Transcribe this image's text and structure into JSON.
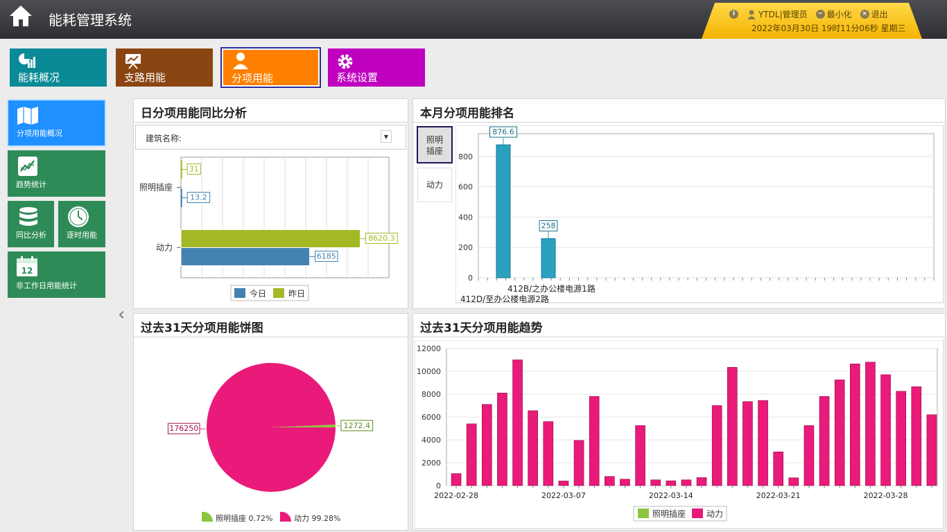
{
  "header": {
    "title": "能耗管理系统",
    "user": "YTDL|管理员",
    "minimize": "最小化",
    "logout": "退出",
    "datetime": "2022年03月30日 19时11分06秒 星期三"
  },
  "nav": {
    "items": [
      {
        "label": "能耗概况",
        "color": "#0a8a96"
      },
      {
        "label": "支路用能",
        "color": "#8b4513"
      },
      {
        "label": "分项用能",
        "color": "#ff8000"
      },
      {
        "label": "系统设置",
        "color": "#bf00bf"
      }
    ]
  },
  "sidebar": {
    "items": [
      {
        "label": "分项用能概况"
      },
      {
        "label": "趋势统计"
      },
      {
        "label": "同比分析"
      },
      {
        "label": "逐时用能"
      },
      {
        "label": "非工作日用能统计"
      }
    ],
    "calendar_day": "12"
  },
  "panels": {
    "daily_compare": {
      "title": "日分项用能同比分析",
      "filter_label": "建筑名称:"
    },
    "monthly_rank": {
      "title": "本月分项用能排名",
      "tabs": [
        "照明插座",
        "动力"
      ]
    },
    "pie31": {
      "title": "过去31天分项用能饼图"
    },
    "trend31": {
      "title": "过去31天分项用能趋势"
    }
  },
  "chart_data": [
    {
      "type": "bar",
      "orientation": "horizontal",
      "categories": [
        "照明插座",
        "动力"
      ],
      "series": [
        {
          "name": "今日",
          "values": [
            13.2,
            6185
          ],
          "color": "#4382b1"
        },
        {
          "name": "昨日",
          "values": [
            31,
            8620.3
          ],
          "color": "#a4b826"
        }
      ],
      "xlim": [
        0,
        10000
      ],
      "legend": "bottom",
      "grid": true
    },
    {
      "type": "bar",
      "categories": [
        "412B/之办公楼电源1路",
        "412D/至办公楼电源2路"
      ],
      "series": [
        {
          "name": "照明插座",
          "values": [
            876.6,
            258
          ],
          "color": "#2ca0bf"
        }
      ],
      "ylim": [
        0,
        950
      ],
      "yticks": [
        0,
        200,
        400,
        600,
        800
      ],
      "grid": true
    },
    {
      "type": "pie",
      "slices": [
        {
          "name": "照明插座",
          "value": 1272.4,
          "percent": "0.72%",
          "color": "#8cc63f"
        },
        {
          "name": "动力",
          "value": 176250,
          "percent": "99.28%",
          "color": "#ea1a7a"
        }
      ],
      "legend": "bottom"
    },
    {
      "type": "bar",
      "x": [
        "2022-02-28",
        "2022-03-01",
        "2022-03-02",
        "2022-03-03",
        "2022-03-04",
        "2022-03-05",
        "2022-03-06",
        "2022-03-07",
        "2022-03-08",
        "2022-03-09",
        "2022-03-10",
        "2022-03-11",
        "2022-03-12",
        "2022-03-13",
        "2022-03-14",
        "2022-03-15",
        "2022-03-16",
        "2022-03-17",
        "2022-03-18",
        "2022-03-19",
        "2022-03-20",
        "2022-03-21",
        "2022-03-22",
        "2022-03-23",
        "2022-03-24",
        "2022-03-25",
        "2022-03-26",
        "2022-03-27",
        "2022-03-28",
        "2022-03-29",
        "2022-03-30"
      ],
      "series": [
        {
          "name": "动力",
          "color": "#ea1a7a",
          "values": [
            1050,
            5400,
            7100,
            8100,
            11000,
            6550,
            5600,
            400,
            3950,
            7800,
            800,
            560,
            5250,
            500,
            420,
            500,
            700,
            7000,
            10350,
            7350,
            7450,
            2950,
            680,
            5250,
            7800,
            9250,
            10650,
            10800,
            9700,
            8250,
            8650,
            6200
          ]
        },
        {
          "name": "照明插座",
          "color": "#8cc63f",
          "values": []
        }
      ],
      "xtick_labels": [
        "2022-02-28",
        "2022-03-07",
        "2022-03-14",
        "2022-03-21",
        "2022-03-28"
      ],
      "ylim": [
        0,
        12000
      ],
      "yticks": [
        0,
        2000,
        4000,
        6000,
        8000,
        10000,
        12000
      ],
      "legend": "bottom",
      "grid": true
    }
  ]
}
